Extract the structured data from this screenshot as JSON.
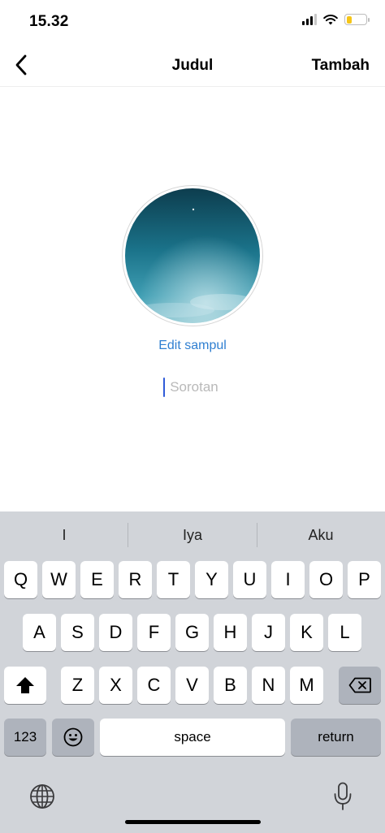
{
  "status": {
    "time": "15.32"
  },
  "nav": {
    "title": "Judul",
    "action": "Tambah"
  },
  "content": {
    "edit_cover": "Edit sampul",
    "highlight_placeholder": "Sorotan"
  },
  "keyboard": {
    "suggestions": [
      "I",
      "Iya",
      "Aku"
    ],
    "row1": [
      "Q",
      "W",
      "E",
      "R",
      "T",
      "Y",
      "U",
      "I",
      "O",
      "P"
    ],
    "row2": [
      "A",
      "S",
      "D",
      "F",
      "G",
      "H",
      "J",
      "K",
      "L"
    ],
    "row3": [
      "Z",
      "X",
      "C",
      "V",
      "B",
      "N",
      "M"
    ],
    "numbers_label": "123",
    "space_label": "space",
    "return_label": "return"
  },
  "icons": {
    "back": "chevron-left-icon",
    "shift": "shift-icon",
    "delete": "backspace-icon",
    "emoji": "emoji-icon",
    "globe": "globe-icon",
    "mic": "microphone-icon",
    "wifi": "wifi-icon",
    "signal": "cellular-signal-icon",
    "battery": "battery-icon"
  },
  "colors": {
    "link": "#2f7fd1",
    "battery_fill": "#f5c518",
    "keyboard_bg": "#d1d4d9"
  },
  "battery_level": 0.3
}
